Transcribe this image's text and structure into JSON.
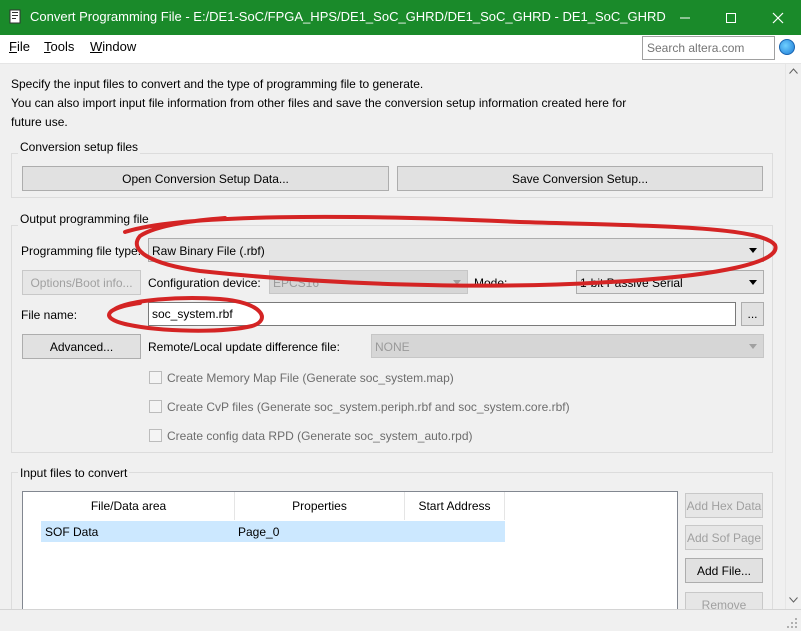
{
  "window": {
    "title": "Convert Programming File - E:/DE1-SoC/FPGA_HPS/DE1_SoC_GHRD/DE1_SoC_GHRD - DE1_SoC_GHRD",
    "app_icon": "quartus-document-icon",
    "controls": [
      "minimize-icon",
      "maximize-icon",
      "close-icon"
    ]
  },
  "menu": {
    "items": [
      {
        "mn": "F",
        "rest": "ile"
      },
      {
        "mn": "T",
        "rest": "ools"
      },
      {
        "mn": "W",
        "rest": "indow"
      }
    ]
  },
  "search": {
    "placeholder": "Search altera.com",
    "icon": "globe-icon"
  },
  "intro": {
    "line1": "Specify the input files to convert and the type of programming file to generate.",
    "line2": "You can also import input file information from other files and save the conversion setup information created here for",
    "line3": "future use."
  },
  "conversion_setup": {
    "legend": "Conversion setup files",
    "open_button": "Open Conversion Setup Data...",
    "save_button": "Save Conversion Setup..."
  },
  "output": {
    "legend": "Output programming file",
    "type_label": "Programming file type:",
    "type_value": "Raw Binary File (.rbf)",
    "options_button": "Options/Boot info...",
    "config_device_label": "Configuration device:",
    "config_device_value": "EPCS16",
    "mode_label": "Mode:",
    "mode_value": "1-bit Passive Serial",
    "file_name_label": "File name:",
    "file_name_value": "soc_system.rbf",
    "browse_button": "...",
    "advanced_button": "Advanced...",
    "remote_label": "Remote/Local update difference file:",
    "remote_value": "NONE",
    "checkboxes": [
      {
        "label": "Create Memory Map File (Generate soc_system.map)",
        "checked": false
      },
      {
        "label": "Create CvP files (Generate soc_system.periph.rbf and soc_system.core.rbf)",
        "checked": false
      },
      {
        "label": "Create config data RPD (Generate soc_system_auto.rpd)",
        "checked": false
      }
    ]
  },
  "input_files": {
    "legend": "Input files to convert",
    "columns": [
      "File/Data area",
      "Properties",
      "Start Address"
    ],
    "rows": [
      {
        "file": "SOF Data",
        "properties": "Page_0",
        "start": ""
      }
    ],
    "buttons": {
      "add_hex": "Add Hex Data",
      "add_sof": "Add Sof Page",
      "add_file": "Add File...",
      "remove": "Remove"
    }
  },
  "colors": {
    "titlebar": "#1a8a2a",
    "annotation": "#d42424",
    "selected_row": "#cce8ff"
  }
}
